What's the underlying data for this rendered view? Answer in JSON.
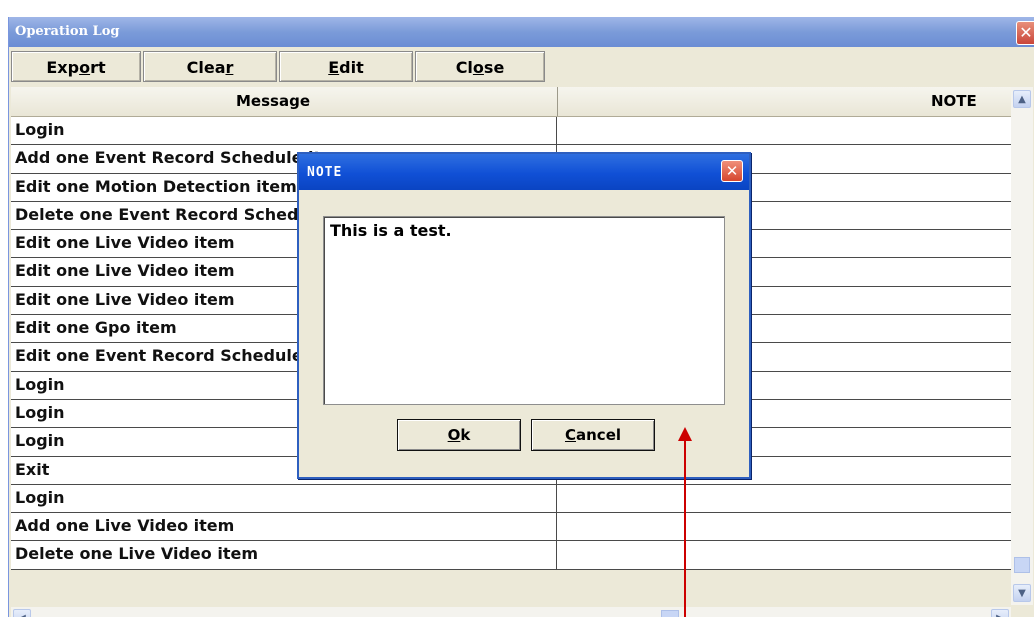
{
  "window": {
    "title": "Operation Log",
    "close_glyph": "✕"
  },
  "toolbar": {
    "export": {
      "pre": "Exp",
      "acc": "o",
      "post": "rt"
    },
    "clear": {
      "pre": "Clea",
      "acc": "r",
      "post": ""
    },
    "edit": {
      "pre": "",
      "acc": "E",
      "post": "dit"
    },
    "close": {
      "pre": "Cl",
      "acc": "o",
      "post": "se"
    }
  },
  "grid": {
    "headers": {
      "message": "Message",
      "note": "NOTE"
    },
    "rows": [
      {
        "message": "Login",
        "note": ""
      },
      {
        "message": "Add  one Event Record Schedule item",
        "note": ""
      },
      {
        "message": "Edit  one Motion Detection item",
        "note": ""
      },
      {
        "message": "Delete  one Event Record Schedule item",
        "note": ""
      },
      {
        "message": "Edit  one Live Video item",
        "note": ""
      },
      {
        "message": "Edit  one Live Video item",
        "note": ""
      },
      {
        "message": "Edit  one Live Video item",
        "note": ""
      },
      {
        "message": "Edit  one Gpo item",
        "note": ""
      },
      {
        "message": "Edit  one Event Record Schedule item",
        "note": ""
      },
      {
        "message": "Login",
        "note": ""
      },
      {
        "message": "Login",
        "note": ""
      },
      {
        "message": "Login",
        "note": ""
      },
      {
        "message": "Exit",
        "note": ""
      },
      {
        "message": "Login",
        "note": ""
      },
      {
        "message": "Add  one Live Video item",
        "note": ""
      },
      {
        "message": "Delete  one Live Video item",
        "note": ""
      }
    ]
  },
  "dialog": {
    "title": "NOTE",
    "close_glyph": "✕",
    "text_value": "This is a test.",
    "ok": {
      "acc": "O",
      "post": "k"
    },
    "cancel": {
      "acc": "C",
      "post": "ancel"
    }
  },
  "icons": {
    "scroll_up": "▲",
    "scroll_down": "▼",
    "scroll_left": "◀",
    "scroll_right": "▶"
  },
  "colors": {
    "window_title_bg": "#7b9bd9",
    "dialog_title_bg": "#1050d6",
    "annotation_arrow": "#cc0000"
  }
}
